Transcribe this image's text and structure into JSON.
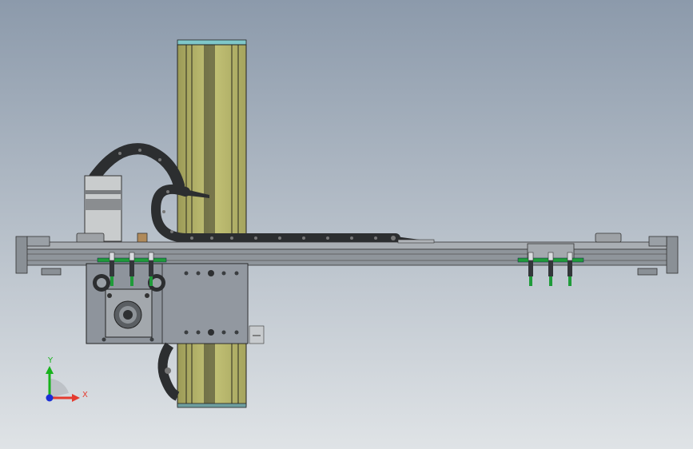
{
  "viewport": {
    "background_top": "#8c9aab",
    "background_bottom": "#dfe3e6"
  },
  "colors": {
    "linear_module": "#b7b66a",
    "rail_steel": "#9aa0a6",
    "plate_steel": "#8e949c",
    "drag_chain": "#2c2e30",
    "sensor_green": "#1f9b3a",
    "coupling_bronze": "#b08a5a",
    "cover_teal": "#7fc7c9"
  },
  "triad": {
    "y_label": "Y",
    "x_label": "X",
    "y_color": "#17b21c",
    "x_color": "#e53b2f",
    "z_color": "#1b2fd6"
  }
}
